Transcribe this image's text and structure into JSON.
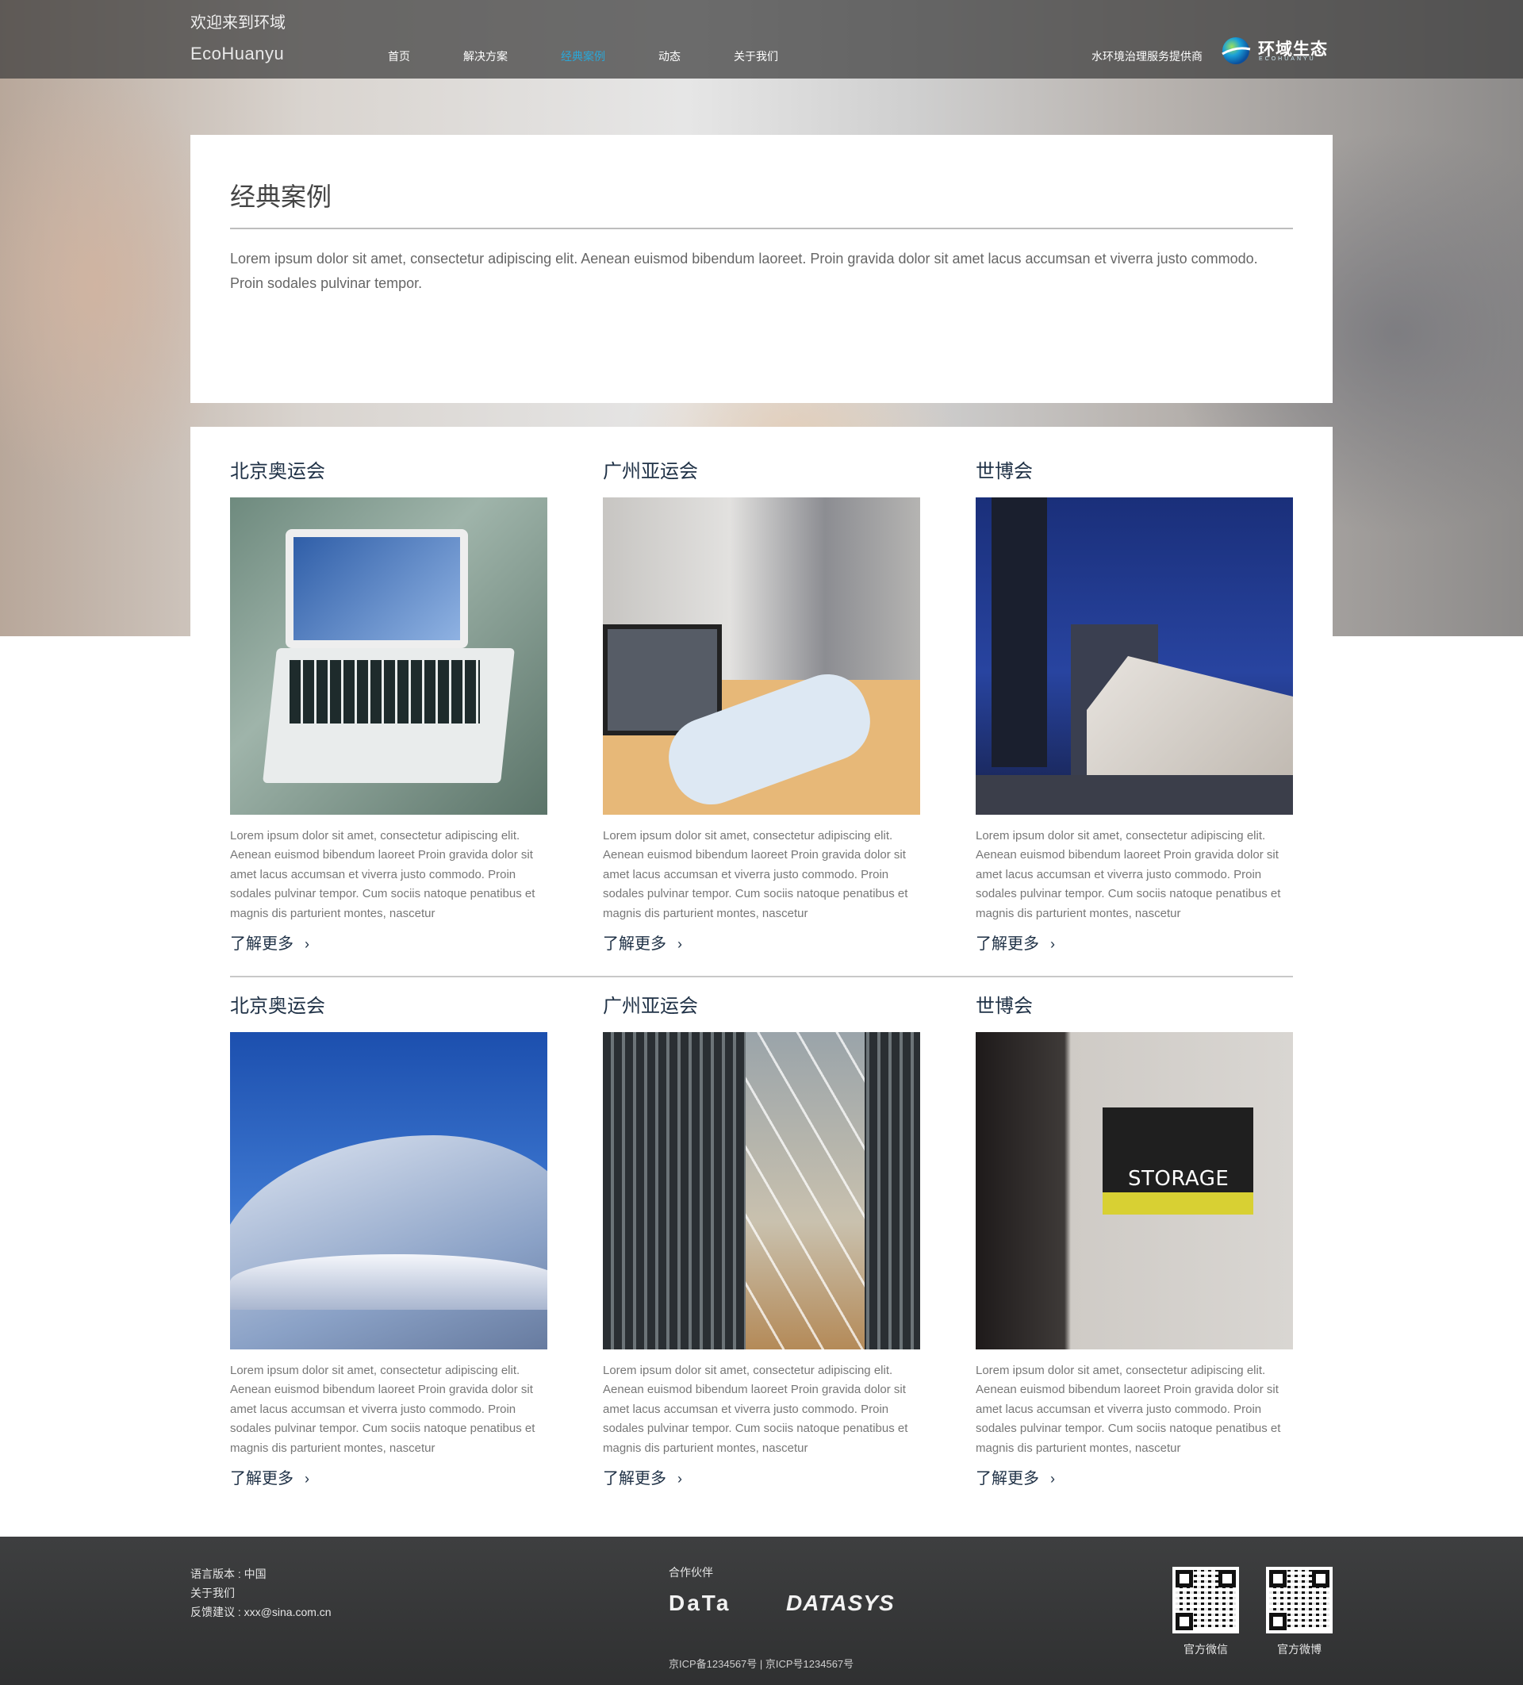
{
  "header": {
    "welcome": "欢迎来到环域",
    "brand_en": "EcoHuanyu",
    "slogan": "水环境治理服务提供商",
    "logo_text": "环域生态",
    "logo_sub": "ECOHUANYU",
    "nav": [
      {
        "label": "首页",
        "active": false
      },
      {
        "label": "解决方案",
        "active": false
      },
      {
        "label": "经典案例",
        "active": true
      },
      {
        "label": "动态",
        "active": false
      },
      {
        "label": "关于我们",
        "active": false
      }
    ],
    "active_color": "#2aa7d8"
  },
  "intro": {
    "title": "经典案例",
    "text": "Lorem ipsum dolor sit amet, consectetur adipiscing elit. Aenean euismod bibendum laoreet. Proin gravida dolor sit amet lacus accumsan et viverra justo commodo. Proin sodales pulvinar tempor."
  },
  "cases": [
    {
      "title": "北京奥运会",
      "image": "laptop-photo",
      "text": "Lorem ipsum dolor sit amet, consectetur adipiscing elit. Aenean euismod bibendum laoreet Proin gravida dolor sit amet lacus accumsan et viverra justo commodo. Proin sodales pulvinar tempor. Cum sociis natoque penatibus et magnis dis parturient montes, nascetur",
      "more": "了解更多"
    },
    {
      "title": "广州亚运会",
      "image": "handshake-photo",
      "text": "Lorem ipsum dolor sit amet, consectetur adipiscing elit. Aenean euismod bibendum laoreet Proin gravida dolor sit amet lacus accumsan et viverra justo commodo. Proin sodales pulvinar tempor. Cum sociis natoque penatibus et magnis dis parturient montes, nascetur",
      "more": "了解更多"
    },
    {
      "title": "世博会",
      "image": "city-night-photo",
      "text": "Lorem ipsum dolor sit amet, consectetur adipiscing elit. Aenean euismod bibendum laoreet Proin gravida dolor sit amet lacus accumsan et viverra justo commodo. Proin sodales pulvinar tempor. Cum sociis natoque penatibus et magnis dis parturient montes, nascetur",
      "more": "了解更多"
    },
    {
      "title": "北京奥运会",
      "image": "architecture-photo",
      "text": "Lorem ipsum dolor sit amet, consectetur adipiscing elit. Aenean euismod bibendum laoreet Proin gravida dolor sit amet lacus accumsan et viverra justo commodo. Proin sodales pulvinar tempor. Cum sociis natoque penatibus et magnis dis parturient montes, nascetur",
      "more": "了解更多"
    },
    {
      "title": "广州亚运会",
      "image": "facade-photo",
      "text": "Lorem ipsum dolor sit amet, consectetur adipiscing elit. Aenean euismod bibendum laoreet Proin gravida dolor sit amet lacus accumsan et viverra justo commodo. Proin sodales pulvinar tempor. Cum sociis natoque penatibus et magnis dis parturient montes, nascetur",
      "more": "了解更多"
    },
    {
      "title": "世博会",
      "image": "storage-sign-photo",
      "sign_text": "STORAGE",
      "text": "Lorem ipsum dolor sit amet, consectetur adipiscing elit. Aenean euismod bibendum laoreet Proin gravida dolor sit amet lacus accumsan et viverra justo commodo. Proin sodales pulvinar tempor. Cum sociis natoque penatibus et magnis dis parturient montes, nascetur",
      "more": "了解更多"
    }
  ],
  "footer": {
    "language": "语言版本 : 中国",
    "about": "关于我们",
    "feedback": "反馈建议 : xxx@sina.com.cn",
    "partners_title": "合作伙伴",
    "partner_1": "DaTa",
    "partner_2": "DATASYS",
    "icp": "京ICP备1234567号  |  京ICP号1234567号",
    "qr_wechat_label": "官方微信",
    "qr_weibo_label": "官方微博"
  }
}
